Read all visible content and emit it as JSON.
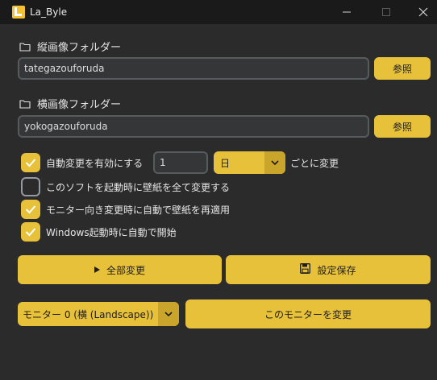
{
  "window": {
    "title": "La_Byle",
    "controls": [
      "minimize-icon",
      "maximize-icon",
      "close-icon"
    ]
  },
  "vertical_folder": {
    "label": "縦画像フォルダー",
    "value": "tategazouforuda",
    "browse_label": "参照"
  },
  "horizontal_folder": {
    "label": "横画像フォルダー",
    "value": "yokogazouforuda",
    "browse_label": "参照"
  },
  "auto_change": {
    "checked": true,
    "label": "自動変更を有効にする",
    "interval_value": "1",
    "unit_selected": "日",
    "suffix": "ごとに変更"
  },
  "options": [
    {
      "label": "このソフトを起動時に壁紙を全て変更する",
      "checked": false
    },
    {
      "label": "モニター向き変更時に自動で壁紙を再適用",
      "checked": true
    },
    {
      "label": "Windows起動時に自動で開始",
      "checked": true
    }
  ],
  "actions": {
    "change_all_label": "全部変更",
    "save_settings_label": "設定保存"
  },
  "monitor": {
    "selected": "モニター 0 (横 (Landscape))",
    "change_label": "このモニターを変更"
  },
  "colors": {
    "accent": "#e8c13a",
    "background": "#2b2b2b",
    "titlebar": "#1a1a1a",
    "input_bg": "#343638"
  }
}
